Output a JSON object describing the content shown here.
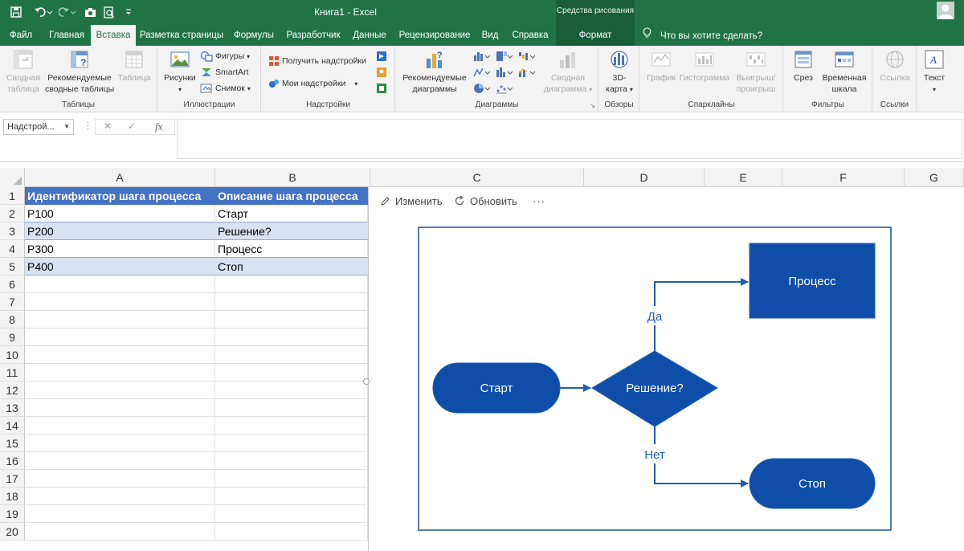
{
  "window": {
    "title": "Книга1 - Excel",
    "drawing_tools": "Средства рисования"
  },
  "tabs": [
    {
      "label": "Файл"
    },
    {
      "label": "Главная"
    },
    {
      "label": "Вставка"
    },
    {
      "label": "Разметка страницы"
    },
    {
      "label": "Формулы"
    },
    {
      "label": "Разработчик"
    },
    {
      "label": "Данные"
    },
    {
      "label": "Рецензирование"
    },
    {
      "label": "Вид"
    },
    {
      "label": "Справка"
    },
    {
      "label": "Формат"
    }
  ],
  "tell_me": "Что вы хотите сделать?",
  "ribbon": {
    "tables": {
      "label": "Таблицы",
      "pivot": [
        "Сводная",
        "таблица"
      ],
      "recommended_pivot": [
        "Рекомендуемые",
        "сводные таблицы"
      ],
      "table": "Таблица"
    },
    "illustrations": {
      "label": "Иллюстрации",
      "pictures": "Рисунки",
      "shapes": "Фигуры",
      "smartart": "SmartArt",
      "screenshot": "Снимок"
    },
    "addins": {
      "label": "Надстройки",
      "get": "Получить надстройки",
      "my": "Мои надстройки"
    },
    "charts": {
      "label": "Диаграммы",
      "recommended": [
        "Рекомендуемые",
        "диаграммы"
      ],
      "pivotchart": [
        "Сводная",
        "диаграмма"
      ]
    },
    "tours": {
      "label": "Обзоры",
      "map3d": [
        "3D-",
        "карта"
      ]
    },
    "sparklines": {
      "label": "Спарклайны",
      "line": "График",
      "column": "Гистограмма",
      "winloss": [
        "Выигрыш/",
        "проигрыш"
      ]
    },
    "filters": {
      "label": "Фильтры",
      "slicer": "Срез",
      "timeline": [
        "Временная",
        "шкала"
      ]
    },
    "links": {
      "label": "Ссылки",
      "link": "Ссылка"
    },
    "text": {
      "label": "Текст"
    }
  },
  "formula_bar": {
    "name_box": "Надстрой...",
    "fx": "fx",
    "value": ""
  },
  "columns": [
    "A",
    "B",
    "C",
    "D",
    "E",
    "F",
    "G"
  ],
  "rows": [
    "1",
    "2",
    "3",
    "4",
    "5",
    "6",
    "7",
    "8",
    "9",
    "10",
    "11",
    "12",
    "13",
    "14",
    "15",
    "16",
    "17",
    "18",
    "19",
    "20"
  ],
  "table": {
    "headers": [
      "Идентификатор шага процесса",
      "Описание шага процесса"
    ],
    "rows": [
      [
        "P100",
        "Старт"
      ],
      [
        "P200",
        "Решение?"
      ],
      [
        "P300",
        "Процесс"
      ],
      [
        "P400",
        "Стоп"
      ]
    ]
  },
  "visual": {
    "edit": "Изменить",
    "refresh": "Обновить",
    "more": "···",
    "nodes": {
      "start": "Старт",
      "decision": "Решение?",
      "process": "Процесс",
      "stop": "Стоп"
    },
    "edge_yes": "Да",
    "edge_no": "Нет",
    "shape_color": "#0e4ea8",
    "connector_color": "#1f5eb6"
  }
}
